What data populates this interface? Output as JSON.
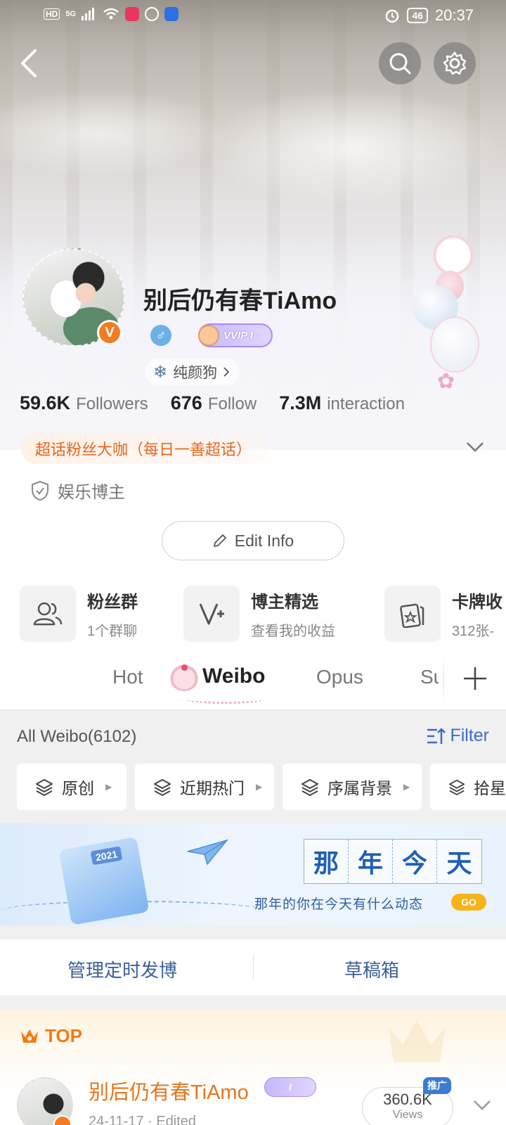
{
  "status_bar": {
    "hd": "HD",
    "network": "5G",
    "battery": "46",
    "time": "20:37"
  },
  "profile": {
    "username": "别后仍有春TiAmo",
    "vvip_badge": "VVIP I",
    "tag": "纯颜狗",
    "verified_mark": "V",
    "gender_symbol": "♂"
  },
  "stats": [
    {
      "value": "59.6K",
      "label": "Followers"
    },
    {
      "value": "676",
      "label": "Follow"
    },
    {
      "value": "7.3M",
      "label": "interaction"
    }
  ],
  "supertopic": "超话粉丝大咖（每日一善超话）",
  "role": "娱乐博主",
  "edit_button": "Edit Info",
  "features": [
    {
      "title": "粉丝群",
      "sub": "1个群聊",
      "icon": "group-icon"
    },
    {
      "title": "博主精选",
      "sub": "查看我的收益",
      "icon": "creator-select-icon"
    },
    {
      "title": "卡牌收",
      "sub": "312张-",
      "icon": "card-icon"
    }
  ],
  "tabs": [
    {
      "label": "Hot",
      "active": false
    },
    {
      "label": "Weibo",
      "active": true
    },
    {
      "label": "Opus",
      "active": false
    },
    {
      "label": "Su",
      "active": false
    }
  ],
  "list": {
    "all_label": "All Weibo(6102)",
    "filter_label": "Filter",
    "chips": [
      "原创",
      "近期热门",
      "序属背景",
      "拾星"
    ]
  },
  "banner": {
    "year": "2021",
    "title_chars": [
      "那",
      "年",
      "今",
      "天"
    ],
    "subtitle": "那年的你在今天有什么动态",
    "go": "GO"
  },
  "manage": {
    "scheduled": "管理定时发博",
    "drafts": "草稿箱"
  },
  "top_post": {
    "top_label": "TOP",
    "author": "别后仍有春TiAmo",
    "badge": "I",
    "date": "24-11-17 · Edited",
    "views_value": "360.6K",
    "views_label": "Views",
    "promo_tag": "推广"
  },
  "colors": {
    "accent_orange": "#f47b20",
    "link_blue": "#3d6bc7",
    "vip_purple": "#a98cf3"
  }
}
